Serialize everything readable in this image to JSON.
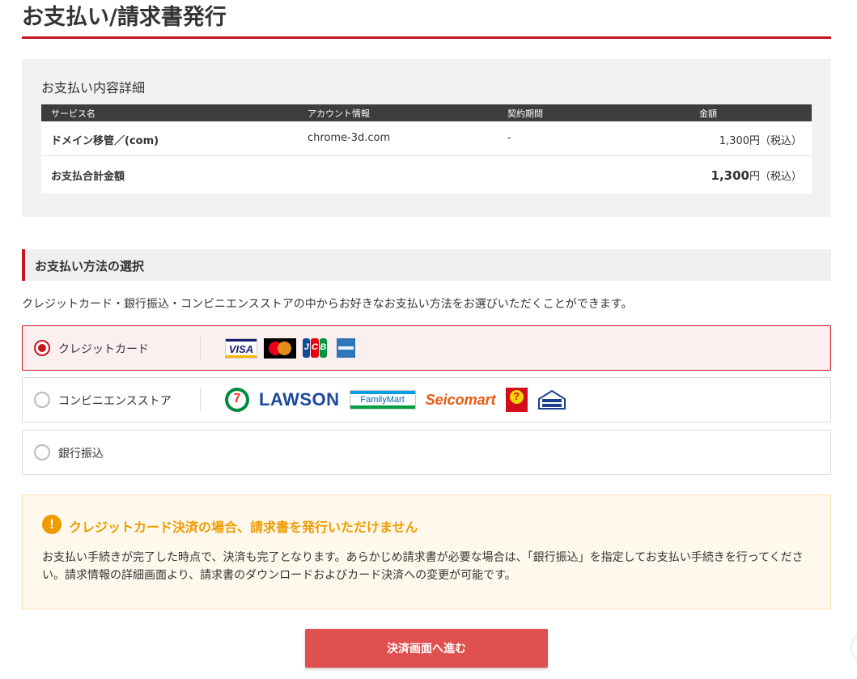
{
  "page": {
    "title": "お支払い/請求書発行"
  },
  "details": {
    "title": "お支払い内容詳細",
    "headers": [
      "サービス名",
      "アカウント情報",
      "契約期間",
      "金額"
    ],
    "rows": [
      {
        "service": "ドメイン移管／(com)",
        "account": "chrome-3d.com",
        "period": "-",
        "amount": "1,300円（税込）"
      }
    ],
    "total": {
      "label": "お支払合計金額",
      "amount": "1,300",
      "suffix": "円（税込）"
    }
  },
  "payment": {
    "section_title": "お支払い方法の選択",
    "description": "クレジットカード・銀行振込・コンビニエンスストアの中からお好きなお支払い方法をお選びいただくことができます。",
    "options": [
      {
        "label": "クレジットカード",
        "selected": true,
        "logos": [
          "visa-logo",
          "mastercard-logo",
          "jcb-logo",
          "amex-logo"
        ]
      },
      {
        "label": "コンビニエンスストア",
        "selected": false,
        "logos": [
          "seven-eleven-logo",
          "lawson-logo",
          "familymart-logo",
          "seicomart-logo",
          "daily-yamazaki-logo",
          "ministop-logo"
        ]
      },
      {
        "label": "銀行振込",
        "selected": false
      }
    ],
    "logo_text": {
      "visa": "VISA",
      "jcb": [
        "J",
        "C",
        "B"
      ],
      "seven": "7",
      "lawson": "LAWSON",
      "familymart": "FamilyMart",
      "seicomart": "Seicomart",
      "daily": "?"
    }
  },
  "notice": {
    "icon": "exclamation-icon",
    "icon_text": "!",
    "title": "クレジットカード決済の場合、請求書を発行いただけません",
    "body": "お支払い手続きが完了した時点で、決済も完了となります。あらかじめ請求書が必要な場合は、「銀行振込」を指定してお支払い手続きを行ってください。請求情報の詳細画面より、請求書のダウンロードおよびカード決済への変更が可能です。"
  },
  "actions": {
    "submit_label": "決済画面へ進む"
  },
  "colors": {
    "accent": "#c8161d",
    "button": "#e05050",
    "warning": "#ef9b00",
    "notice_bg": "#fff9ed"
  }
}
